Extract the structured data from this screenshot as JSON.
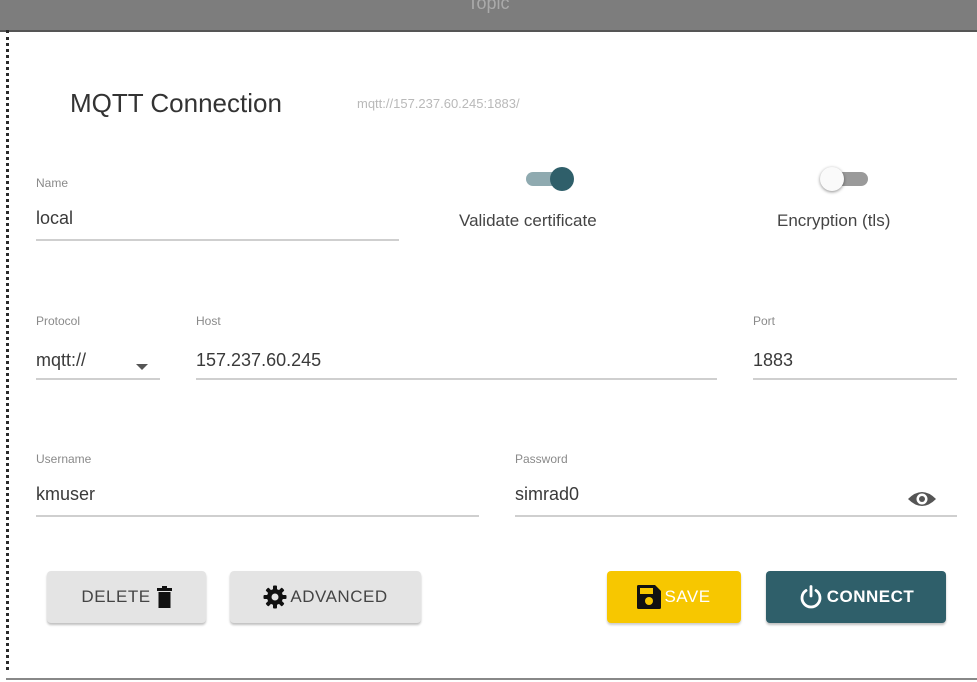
{
  "topbar": {
    "title": "Topic"
  },
  "dialog": {
    "title": "MQTT Connection",
    "url": "mqtt://157.237.60.245:1883/"
  },
  "fields": {
    "name": {
      "label": "Name",
      "value": "local"
    },
    "protocol": {
      "label": "Protocol",
      "value": "mqtt://"
    },
    "host": {
      "label": "Host",
      "value": "157.237.60.245"
    },
    "port": {
      "label": "Port",
      "value": "1883"
    },
    "username": {
      "label": "Username",
      "value": "kmuser"
    },
    "password": {
      "label": "Password",
      "value": "simrad0"
    }
  },
  "toggles": {
    "validate_certificate": {
      "label": "Validate certificate",
      "on": true
    },
    "encryption": {
      "label": "Encryption (tls)",
      "on": false
    }
  },
  "buttons": {
    "delete": "DELETE",
    "advanced": "ADVANCED",
    "save": "SAVE",
    "connect": "CONNECT"
  },
  "icons": {
    "protocol_dropdown": "caret-down-icon",
    "password_visibility": "eye-icon",
    "delete": "trash-icon",
    "advanced": "gear-icon",
    "save": "floppy-disk-icon",
    "connect": "power-icon"
  },
  "colors": {
    "toggle_on_thumb": "#2f5f6a",
    "toggle_on_track": "#8faab0",
    "save_button": "#f7c700",
    "connect_button": "#2f5f6a"
  }
}
